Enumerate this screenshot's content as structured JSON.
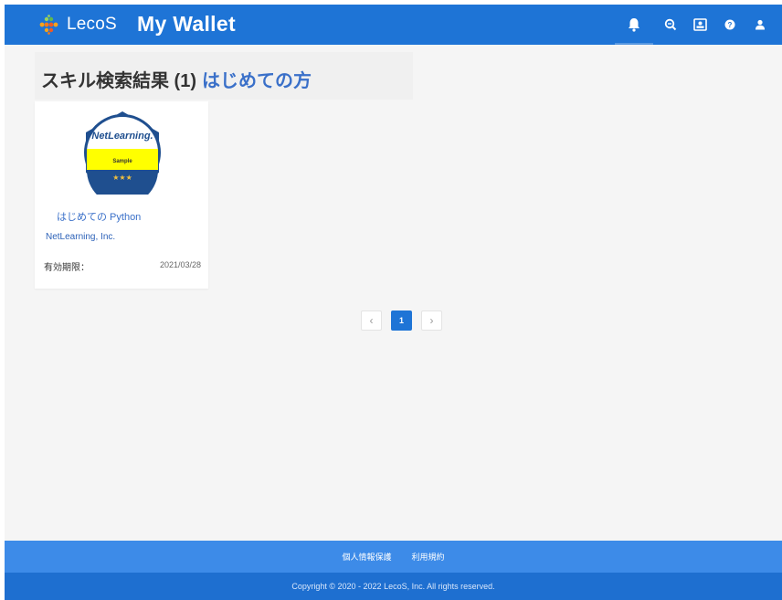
{
  "header": {
    "logo_text": "LecoS",
    "app_title": "My Wallet",
    "icons": [
      "bell-icon",
      "search-circle-icon",
      "profile-card-icon",
      "help-icon",
      "user-icon"
    ]
  },
  "page": {
    "title": "スキル検索結果 (1)",
    "keyword": "はじめての方"
  },
  "results": [
    {
      "badge_brand": "NetLearning.",
      "badge_label": "Sample",
      "badge_stars": "★★★",
      "course_name": "はじめての Python",
      "org": "NetLearning, Inc.",
      "expiry_label": "有効期限：",
      "expiry_date": "2021/03/28"
    }
  ],
  "pagination": {
    "prev": "‹",
    "current": "1",
    "next": "›"
  },
  "footer": {
    "privacy": "個人情報保護",
    "terms": "利用規約",
    "copyright": "Copyright © 2020 - 2022 LecoS, Inc. All rights reserved."
  },
  "colors": {
    "primary": "#1e74d6",
    "footer_links": "#3d8be8",
    "badge_yellow": "#ffff00",
    "badge_blue": "#1f4f8f"
  }
}
